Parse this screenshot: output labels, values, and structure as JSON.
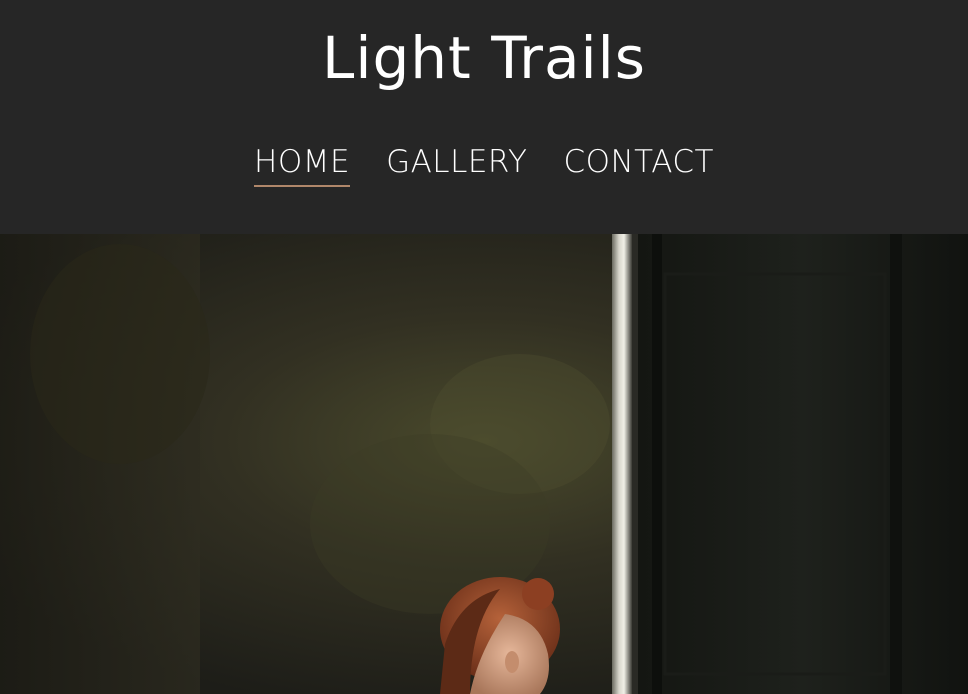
{
  "site": {
    "title": "Light Trails"
  },
  "nav": {
    "items": [
      {
        "label": "HOME",
        "active": true
      },
      {
        "label": "GALLERY",
        "active": false
      },
      {
        "label": "CONTACT",
        "active": false
      }
    ]
  },
  "colors": {
    "header_bg": "#262626",
    "text": "#ffffff",
    "active_underline": "#b0876a"
  },
  "hero": {
    "image_name": "portrait-photo"
  }
}
